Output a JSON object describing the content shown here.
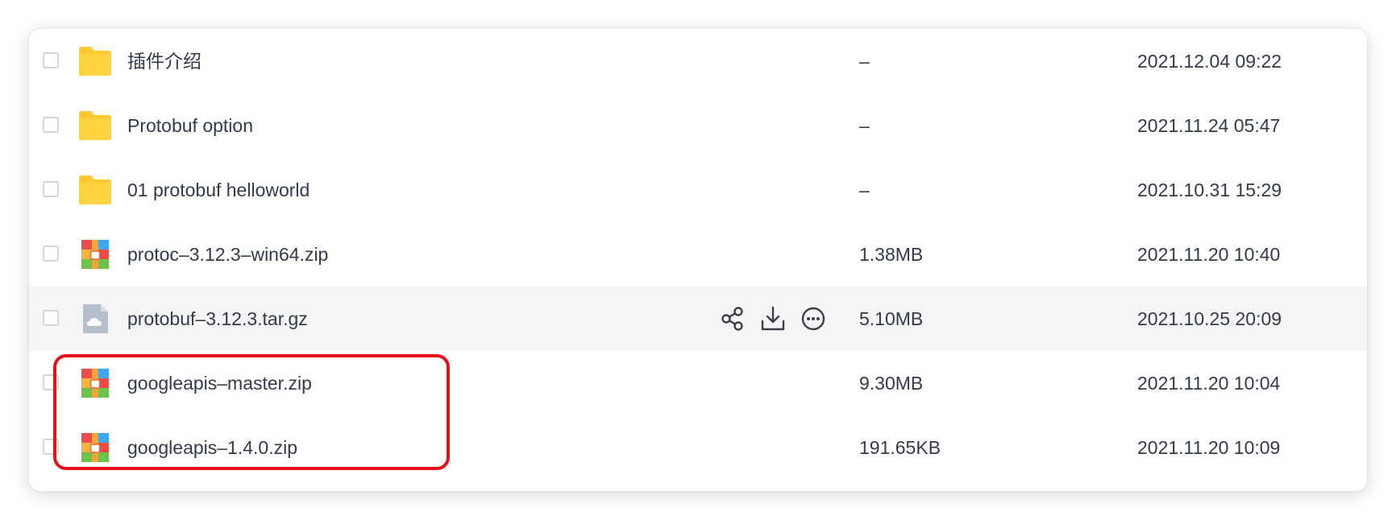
{
  "files": [
    {
      "name": "插件介绍",
      "size": "–",
      "date": "2021.12.04 09:22",
      "icon": "folder-icon"
    },
    {
      "name": "Protobuf option",
      "size": "–",
      "date": "2021.11.24 05:47",
      "icon": "folder-icon"
    },
    {
      "name": "01 protobuf helloworld",
      "size": "–",
      "date": "2021.10.31 15:29",
      "icon": "folder-icon"
    },
    {
      "name": "protoc–3.12.3–win64.zip",
      "size": "1.38MB",
      "date": "2021.11.20 10:40",
      "icon": "zip-archive-icon"
    },
    {
      "name": "protobuf–3.12.3.tar.gz",
      "size": "5.10MB",
      "date": "2021.10.25 20:09",
      "icon": "cloud-file-icon"
    },
    {
      "name": "googleapis–master.zip",
      "size": "9.30MB",
      "date": "2021.11.20 10:04",
      "icon": "zip-archive-icon"
    },
    {
      "name": "googleapis–1.4.0.zip",
      "size": "191.65KB",
      "date": "2021.11.20 10:09",
      "icon": "zip-archive-icon"
    }
  ],
  "hover_actions": [
    "share-icon",
    "download-icon",
    "more-icon"
  ],
  "colors": {
    "folder": "#ffc934",
    "text": "#333a4a",
    "hover_row": "#f5f5f6",
    "highlight": "#e8101a",
    "cloud_file": "#b4bfcd"
  }
}
